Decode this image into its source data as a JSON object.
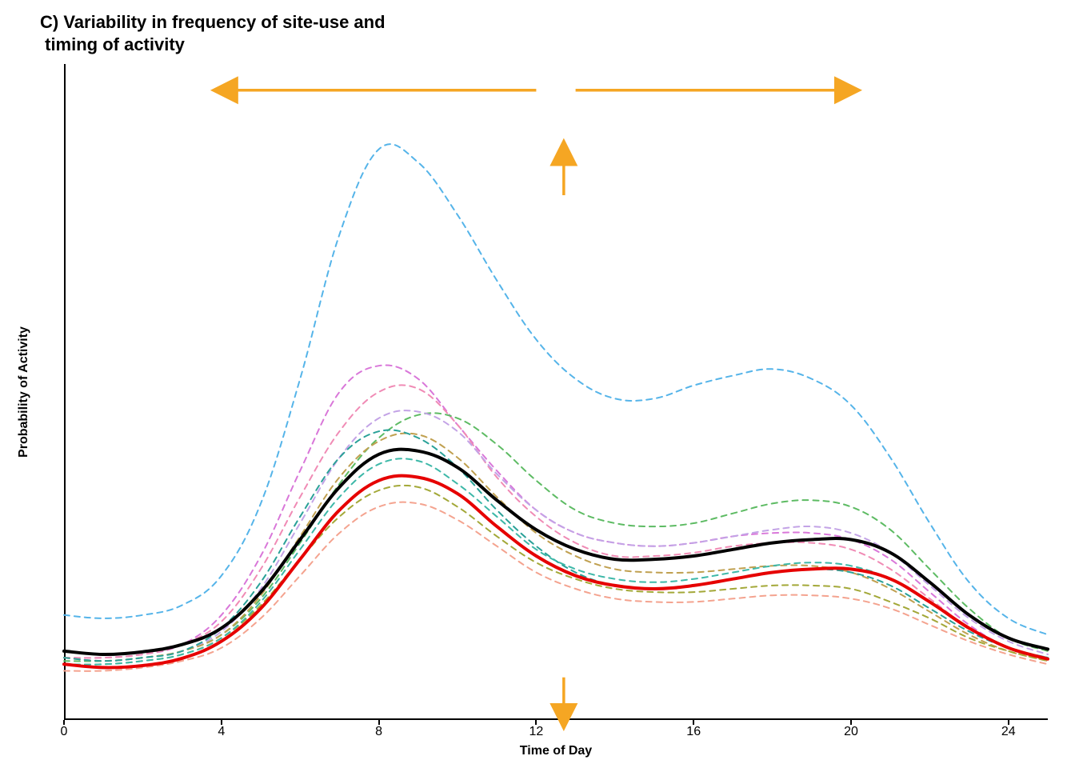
{
  "title": "C) Variability in frequency of site-use and\n timing of activity",
  "ylabel": "Probability of Activity",
  "xlabel": "Time of Day",
  "chart_data": {
    "type": "line",
    "xlabel": "Time of Day",
    "ylabel": "Probability of Activity",
    "title": "C) Variability in frequency of site-use and timing of activity",
    "xlim": [
      0,
      25
    ],
    "ylim": [
      0,
      1
    ],
    "x_ticks": [
      0,
      4,
      8,
      12,
      16,
      20,
      24
    ],
    "y_ticks_shown": false,
    "annotations": {
      "horizontal_arrows": {
        "left_from": 12,
        "left_to": 4,
        "right_from": 13,
        "right_to": 20,
        "y": 0.96
      },
      "up_arrow": {
        "x": 12.7,
        "y_from": 0.8,
        "y_to": 0.87
      },
      "down_arrow": {
        "x": 12.7,
        "y_from": 0.065,
        "y_to": 0.0
      }
    },
    "x": [
      0,
      1,
      2,
      3,
      4,
      5,
      6,
      7,
      8,
      9,
      10,
      11,
      12,
      13,
      14,
      15,
      16,
      17,
      18,
      19,
      20,
      21,
      22,
      23,
      24,
      25
    ],
    "series": [
      {
        "name": "site_blue_high",
        "style": "dashed",
        "color": "#55b4e9",
        "values": [
          0.16,
          0.155,
          0.16,
          0.175,
          0.22,
          0.33,
          0.52,
          0.74,
          0.87,
          0.85,
          0.77,
          0.67,
          0.58,
          0.52,
          0.49,
          0.49,
          0.51,
          0.525,
          0.535,
          0.52,
          0.48,
          0.4,
          0.3,
          0.21,
          0.155,
          0.13
        ]
      },
      {
        "name": "site_orchid",
        "style": "dashed",
        "color": "#d977d9",
        "values": [
          0.095,
          0.095,
          0.1,
          0.115,
          0.16,
          0.25,
          0.38,
          0.5,
          0.54,
          0.52,
          0.45,
          0.38,
          0.32,
          0.285,
          0.27,
          0.265,
          0.27,
          0.28,
          0.285,
          0.285,
          0.275,
          0.245,
          0.195,
          0.145,
          0.11,
          0.095
        ]
      },
      {
        "name": "site_pink",
        "style": "dashed",
        "color": "#f08bb5",
        "values": [
          0.095,
          0.095,
          0.1,
          0.115,
          0.15,
          0.23,
          0.34,
          0.44,
          0.5,
          0.505,
          0.45,
          0.37,
          0.31,
          0.27,
          0.25,
          0.25,
          0.255,
          0.265,
          0.27,
          0.27,
          0.26,
          0.23,
          0.185,
          0.14,
          0.11,
          0.095
        ]
      },
      {
        "name": "site_green",
        "style": "dashed",
        "color": "#5dbb63",
        "values": [
          0.09,
          0.09,
          0.095,
          0.105,
          0.13,
          0.185,
          0.27,
          0.36,
          0.43,
          0.465,
          0.46,
          0.42,
          0.365,
          0.32,
          0.3,
          0.295,
          0.3,
          0.315,
          0.33,
          0.335,
          0.325,
          0.29,
          0.23,
          0.17,
          0.125,
          0.105
        ]
      },
      {
        "name": "site_lavender",
        "style": "dashed",
        "color": "#c3a3e6",
        "values": [
          0.095,
          0.09,
          0.095,
          0.105,
          0.135,
          0.2,
          0.3,
          0.4,
          0.46,
          0.47,
          0.44,
          0.375,
          0.32,
          0.285,
          0.27,
          0.265,
          0.27,
          0.28,
          0.29,
          0.295,
          0.285,
          0.255,
          0.205,
          0.155,
          0.12,
          0.1
        ]
      },
      {
        "name": "site_tan",
        "style": "dashed",
        "color": "#c0a050",
        "values": [
          0.095,
          0.09,
          0.095,
          0.105,
          0.13,
          0.19,
          0.28,
          0.37,
          0.425,
          0.435,
          0.4,
          0.34,
          0.285,
          0.25,
          0.23,
          0.225,
          0.225,
          0.23,
          0.235,
          0.235,
          0.225,
          0.2,
          0.165,
          0.13,
          0.105,
          0.09
        ]
      },
      {
        "name": "site_teal",
        "style": "dashed",
        "color": "#2aa198",
        "values": [
          0.095,
          0.09,
          0.095,
          0.105,
          0.14,
          0.21,
          0.31,
          0.4,
          0.44,
          0.43,
          0.385,
          0.32,
          0.265,
          0.225,
          0.205,
          0.2,
          0.205,
          0.215,
          0.225,
          0.23,
          0.225,
          0.205,
          0.17,
          0.135,
          0.11,
          0.095
        ]
      },
      {
        "name": "site_olive",
        "style": "dashed",
        "color": "#a3a838",
        "values": [
          0.085,
          0.085,
          0.09,
          0.1,
          0.125,
          0.175,
          0.245,
          0.31,
          0.35,
          0.355,
          0.325,
          0.28,
          0.24,
          0.215,
          0.2,
          0.195,
          0.195,
          0.2,
          0.205,
          0.205,
          0.2,
          0.18,
          0.155,
          0.125,
          0.105,
          0.09
        ]
      },
      {
        "name": "site_salmon",
        "style": "dashed",
        "color": "#f4a38f",
        "values": [
          0.075,
          0.075,
          0.08,
          0.09,
          0.11,
          0.155,
          0.22,
          0.285,
          0.325,
          0.33,
          0.305,
          0.265,
          0.225,
          0.2,
          0.185,
          0.18,
          0.18,
          0.185,
          0.19,
          0.19,
          0.185,
          0.17,
          0.145,
          0.12,
          0.1,
          0.085
        ]
      },
      {
        "name": "site_teal2",
        "style": "dashed",
        "color": "#3db8a8",
        "values": [
          0.085,
          0.085,
          0.09,
          0.1,
          0.125,
          0.18,
          0.26,
          0.34,
          0.39,
          0.395,
          0.36,
          0.31,
          0.26,
          0.23,
          0.215,
          0.21,
          0.215,
          0.225,
          0.235,
          0.24,
          0.235,
          0.215,
          0.18,
          0.14,
          0.11,
          0.095
        ]
      },
      {
        "name": "black_mean",
        "style": "solid",
        "color": "#000000",
        "width": 4,
        "values": [
          0.105,
          0.1,
          0.104,
          0.115,
          0.14,
          0.195,
          0.275,
          0.355,
          0.405,
          0.41,
          0.385,
          0.335,
          0.29,
          0.26,
          0.245,
          0.245,
          0.25,
          0.26,
          0.27,
          0.275,
          0.275,
          0.255,
          0.21,
          0.16,
          0.125,
          0.108
        ]
      },
      {
        "name": "red_curve",
        "style": "solid",
        "color": "#e60000",
        "width": 4,
        "values": [
          0.085,
          0.08,
          0.083,
          0.094,
          0.12,
          0.17,
          0.245,
          0.32,
          0.365,
          0.37,
          0.345,
          0.295,
          0.25,
          0.22,
          0.205,
          0.2,
          0.205,
          0.215,
          0.225,
          0.23,
          0.23,
          0.215,
          0.18,
          0.14,
          0.11,
          0.093
        ]
      }
    ]
  }
}
